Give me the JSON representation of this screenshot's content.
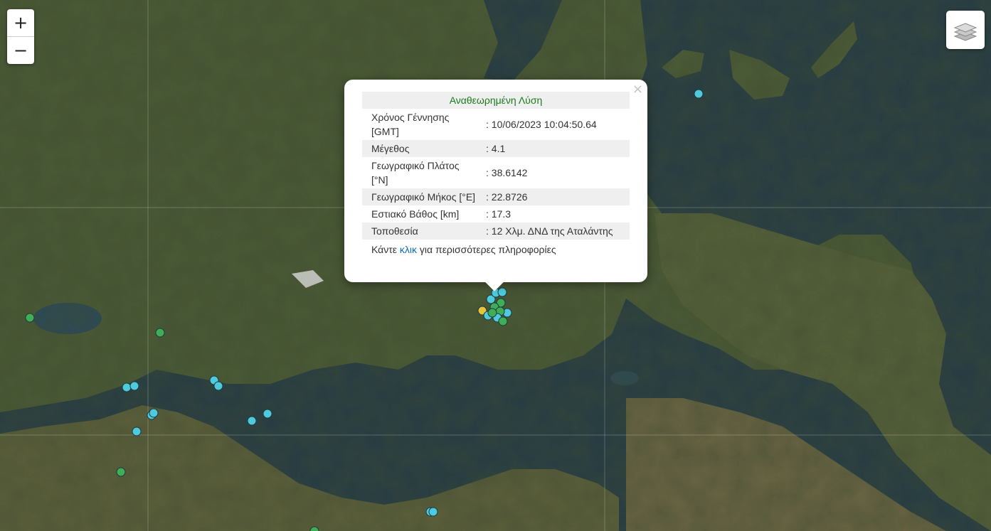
{
  "map": {
    "zoom_in_label": "+",
    "zoom_out_label": "−",
    "layers_icon": "layers-icon"
  },
  "popup": {
    "close_label": "×",
    "heading": "Αναθεωρημένη Λύση",
    "rows": [
      {
        "label": "Χρόνος Γέννησης [GMT]",
        "value": ": 10/06/2023 10:04:50.64"
      },
      {
        "label": "Μέγεθος",
        "value": ": 4.1"
      },
      {
        "label": "Γεωγραφικό Πλάτος [°N]",
        "value": ": 38.6142"
      },
      {
        "label": "Γεωγραφικό Μήκος [°E]",
        "value": ": 22.8726"
      },
      {
        "label": "Εστιακό Βάθος [km]",
        "value": ": 17.3"
      },
      {
        "label": "Τοποθεσία",
        "value": ": 12 Χλμ. ΔΝΔ της Αταλάντης"
      }
    ],
    "more_prefix": "Κάντε ",
    "more_link": "κλικ",
    "more_suffix": " για περισσότερες πληροφορίες"
  },
  "colors": {
    "marker_cyan": "#4fc9dc",
    "marker_green": "#3fae56",
    "marker_yellow": "#e5c33b",
    "heading_green": "#1a7a1a",
    "link_blue": "#0a6db8"
  }
}
